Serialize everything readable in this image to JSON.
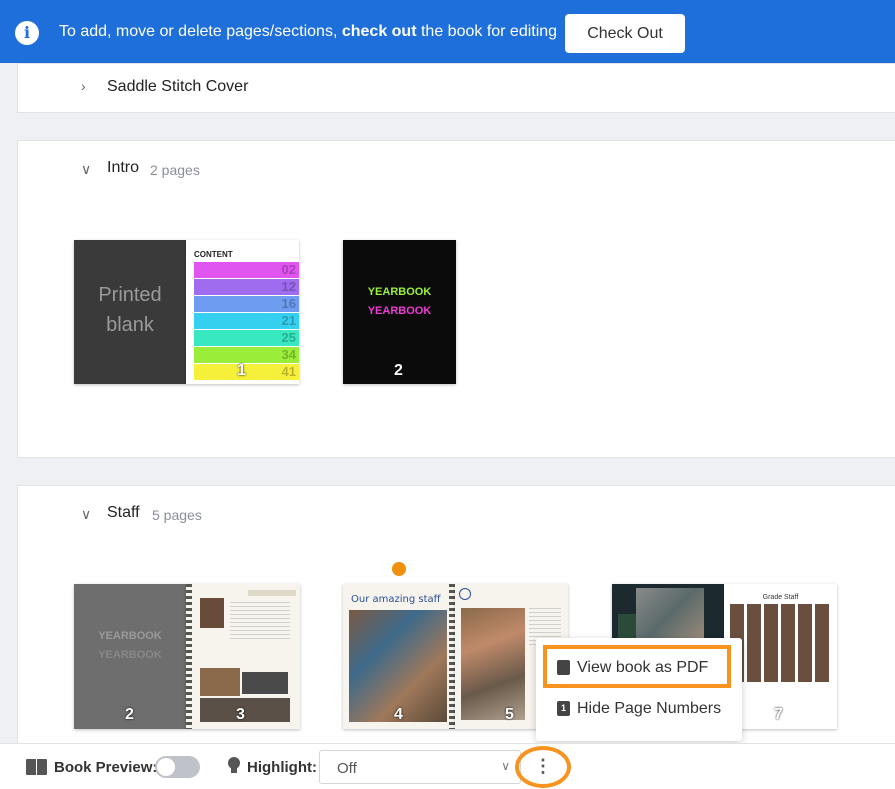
{
  "banner": {
    "message_before": "To add, move or delete pages/sections,",
    "message_bold": "check out",
    "message_after": "the book for editing",
    "checkout_label": "Check Out",
    "info_glyph": "i"
  },
  "sections": [
    {
      "title": "Saddle Stitch Cover",
      "count": ""
    },
    {
      "title": "Intro",
      "count": "2 pages"
    },
    {
      "title": "Staff",
      "count": "5 pages"
    }
  ],
  "intro_pages": {
    "blank_text_line1": "Printed",
    "blank_text_line2": "blank",
    "toc_header": "CONTENT",
    "toc_numbers": [
      "02",
      "12",
      "16",
      "21",
      "25",
      "34",
      "41"
    ],
    "toc_colors": [
      "#e055f0",
      "#9f6cf0",
      "#6d9cf0",
      "#35d0ef",
      "#38e8c0",
      "#9aee3a",
      "#f5f03a"
    ],
    "page1_num": "1",
    "page2_num": "2",
    "yearbook_text": "YEARBOOK"
  },
  "staff_pages": {
    "page2_num": "2",
    "page3_num": "3",
    "page4_num": "4",
    "page5_num": "5",
    "page7_num": "7",
    "our_staff_title": "Our amazing staff",
    "grade_staff_title": "Grade Staff",
    "yearbook_text": "YEARBOOK"
  },
  "menu": {
    "view_pdf": "View book as PDF",
    "hide_numbers": "Hide Page Numbers",
    "hide_numbers_icon_glyph": "1"
  },
  "toolbar": {
    "book_preview_label": "Book Preview:",
    "highlight_label": "Highlight:",
    "highlight_value": "Off",
    "more_glyph": "⋮"
  },
  "colors": {
    "banner": "#1e6fd9",
    "highlight_orange": "#f7931e"
  }
}
